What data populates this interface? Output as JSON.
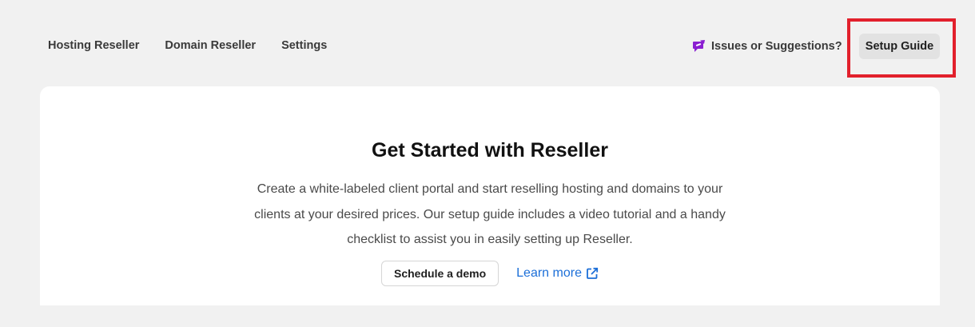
{
  "nav": {
    "items": [
      {
        "label": "Hosting Reseller"
      },
      {
        "label": "Domain Reseller"
      },
      {
        "label": "Settings"
      }
    ],
    "issues_label": "Issues or Suggestions?",
    "issues_icon": "feedback-icon",
    "setup_label": "Setup Guide"
  },
  "card": {
    "title": "Get Started with Reseller",
    "description": "Create a white-labeled client portal and start reselling hosting and domains to your clients at your desired prices. Our setup guide includes a video tutorial and a handy checklist to assist you in easily setting up Reseller.",
    "demo_label": "Schedule a demo",
    "learn_more_label": "Learn more",
    "learn_more_icon": "external-link-icon"
  },
  "colors": {
    "accent_purple": "#8a1fd1",
    "link_blue": "#1c6fd8",
    "highlight_red": "#e2202c"
  }
}
